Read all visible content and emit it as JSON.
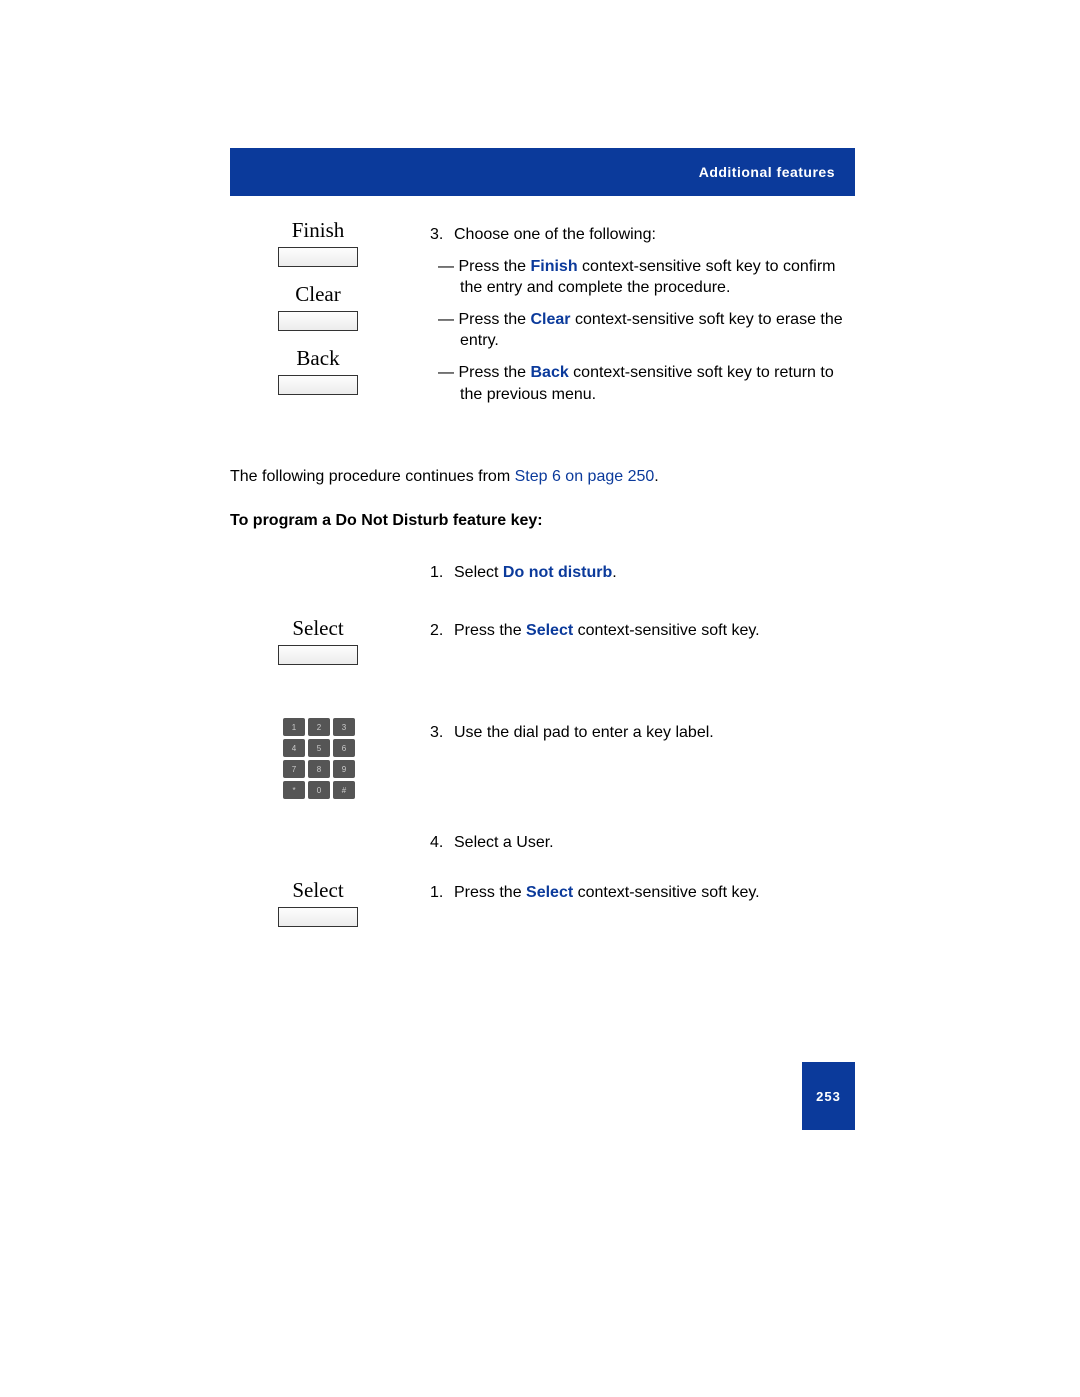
{
  "header": {
    "title": "Additional features"
  },
  "softkeys": {
    "finish": "Finish",
    "clear": "Clear",
    "back": "Back",
    "select": "Select"
  },
  "step3": {
    "num": "3.",
    "text": "Choose one of the following:",
    "bullet1_pre": "Press the ",
    "bullet1_b": "Finish",
    "bullet1_post": " context-sensitive soft key to confirm the entry and complete the procedure.",
    "bullet2_pre": "Press the ",
    "bullet2_b": "Clear",
    "bullet2_post": " context-sensitive soft key to erase the entry.",
    "bullet3_pre": "Press the ",
    "bullet3_b": "Back",
    "bullet3_post": " context-sensitive soft key to return to the previous menu."
  },
  "continue": {
    "pre": "The following procedure continues from  ",
    "link": "Step 6 on page 250",
    "post": "."
  },
  "proc_heading": "To program a Do Not Disturb feature key:",
  "dnd": {
    "s1_num": "1.",
    "s1_pre": "Select ",
    "s1_b": "Do not disturb",
    "s1_post": ".",
    "s2_num": "2.",
    "s2_pre": "Press the ",
    "s2_b": "Select",
    "s2_post": " context-sensitive soft key.",
    "s3_num": "3.",
    "s3_text": "Use the dial pad to enter a key label.",
    "s4_num": "4.",
    "s4_text": "Select a User.",
    "s5_num": "1.",
    "s5_pre": "Press the ",
    "s5_b": "Select",
    "s5_post": " context-sensitive soft key."
  },
  "page_number": "253"
}
